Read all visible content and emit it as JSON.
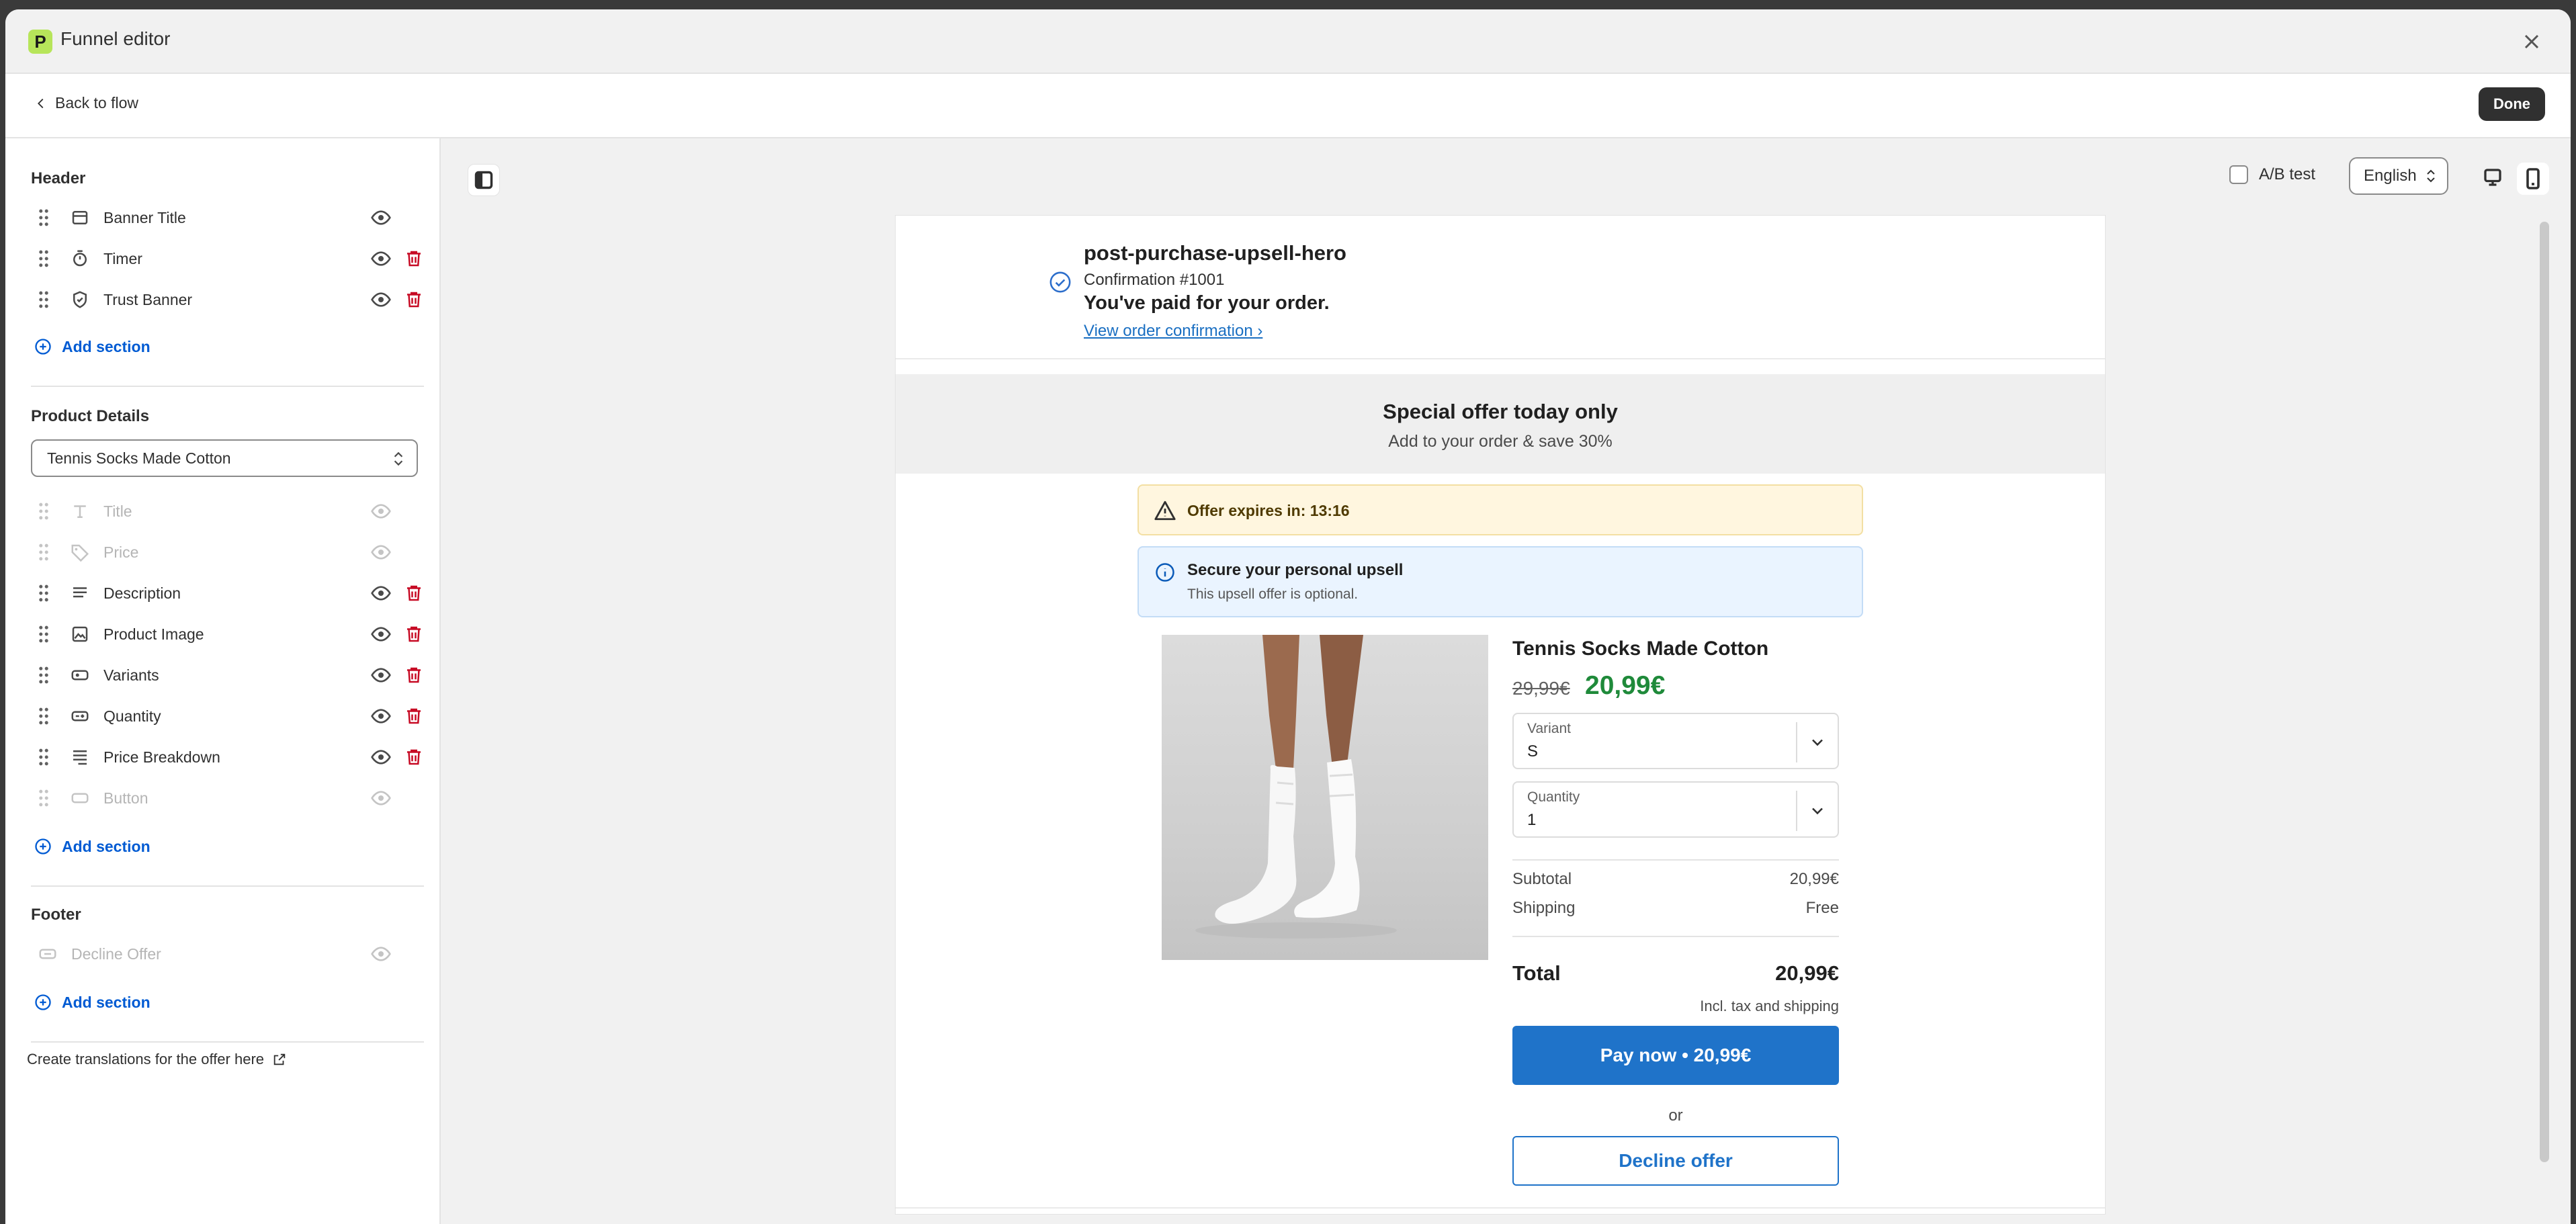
{
  "window": {
    "title": "Funnel editor"
  },
  "subbar": {
    "back_label": "Back to flow",
    "done_label": "Done"
  },
  "sidebar": {
    "header": {
      "title": "Header",
      "items": [
        {
          "label": "Banner Title",
          "icon": "banner-icon"
        },
        {
          "label": "Timer",
          "icon": "timer-icon"
        },
        {
          "label": "Trust Banner",
          "icon": "shield-icon"
        }
      ],
      "add_label": "Add section"
    },
    "product": {
      "title": "Product Details",
      "select_value": "Tennis Socks Made Cotton",
      "items": [
        {
          "label": "Title",
          "icon": "title-icon",
          "hidden": true
        },
        {
          "label": "Price",
          "icon": "tag-icon",
          "hidden": true
        },
        {
          "label": "Description",
          "icon": "text-icon",
          "hidden": false
        },
        {
          "label": "Product Image",
          "icon": "image-icon",
          "hidden": false
        },
        {
          "label": "Variants",
          "icon": "variant-icon",
          "hidden": false
        },
        {
          "label": "Quantity",
          "icon": "quantity-icon",
          "hidden": false
        },
        {
          "label": "Price Breakdown",
          "icon": "list-icon",
          "hidden": false
        },
        {
          "label": "Button",
          "icon": "button-icon",
          "hidden": true
        }
      ],
      "add_label": "Add section"
    },
    "footer": {
      "title": "Footer",
      "items": [
        {
          "label": "Decline Offer",
          "icon": "button-icon",
          "hidden": true
        }
      ],
      "add_label": "Add section"
    },
    "translations_link": "Create translations for the offer here"
  },
  "toolbar": {
    "ab_label": "A/B test",
    "language": "English"
  },
  "preview": {
    "confirmation": {
      "title": "post-purchase-upsell-hero",
      "number": "Confirmation #1001",
      "paid": "You've paid for your order.",
      "link": "View order confirmation ›"
    },
    "banner": {
      "title": "Special offer today only",
      "subtitle": "Add to your order & save 30%"
    },
    "timer": {
      "text": "Offer expires in: 13:16"
    },
    "notice": {
      "title": "Secure your personal upsell",
      "subtitle": "This upsell offer is optional."
    },
    "product": {
      "name": "Tennis Socks Made Cotton",
      "old_price": "29,99€",
      "new_price": "20,99€",
      "variant_label": "Variant",
      "variant_value": "S",
      "quantity_label": "Quantity",
      "quantity_value": "1",
      "subtotal_label": "Subtotal",
      "subtotal_value": "20,99€",
      "shipping_label": "Shipping",
      "shipping_value": "Free",
      "total_label": "Total",
      "total_value": "20,99€",
      "incl": "Incl. tax and shipping",
      "pay_label": "Pay now • 20,99€",
      "or": "or",
      "decline_label": "Decline offer"
    }
  },
  "colors": {
    "accent": "#005bd3",
    "pay": "#1f73c9",
    "price": "#1f8a3a",
    "delete": "#c70a24",
    "logo": "#b7e55a"
  }
}
